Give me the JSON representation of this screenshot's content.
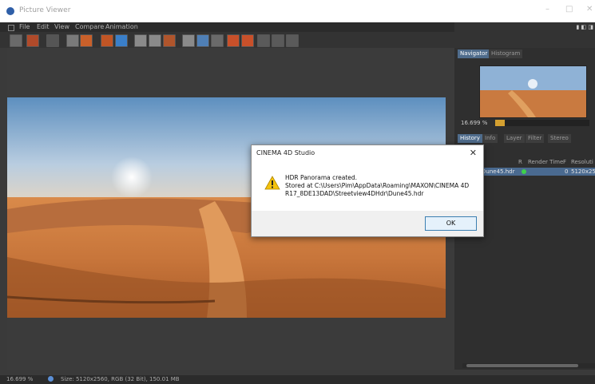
{
  "window": {
    "title": "Picture Viewer",
    "icon": "cinema4d-icon",
    "controls": [
      "–",
      "□",
      "✕"
    ]
  },
  "menu": [
    "File",
    "Edit",
    "View",
    "Compare",
    "Animation"
  ],
  "navigator": {
    "tabs": [
      "Navigator",
      "Histogram"
    ],
    "active_tab": "Navigator",
    "zoom_text": "16.699 %",
    "zoom_fraction": 0.1
  },
  "panel_tabs": {
    "tabs": [
      "History",
      "Info",
      "Layer",
      "Filter",
      "Stereo"
    ],
    "active_tab": "History"
  },
  "history": {
    "columns": [
      "R",
      "Render Time",
      "F",
      "Resoluti"
    ],
    "rows": [
      {
        "name": "Dune45.hdr",
        "status_color": "#3fd14a",
        "render_time": "0",
        "resolution": "5120x25"
      }
    ]
  },
  "statusbar": {
    "zoom": "16.699 %",
    "info": "Size: 5120x2560, RGB (32 Bit), 150.01 MB"
  },
  "dialog": {
    "title": "CINEMA 4D Studio",
    "icon": "warning-icon",
    "message_line1": "HDR Panorama created.",
    "message_line2": "Stored at C:\\Users\\Pim\\AppData\\Roaming\\MAXON\\CINEMA 4D",
    "message_line3": "R17_8DE13DAD\\Streetview4DHdr\\Dune45.hdr",
    "ok_label": "OK",
    "close_glyph": "✕"
  }
}
